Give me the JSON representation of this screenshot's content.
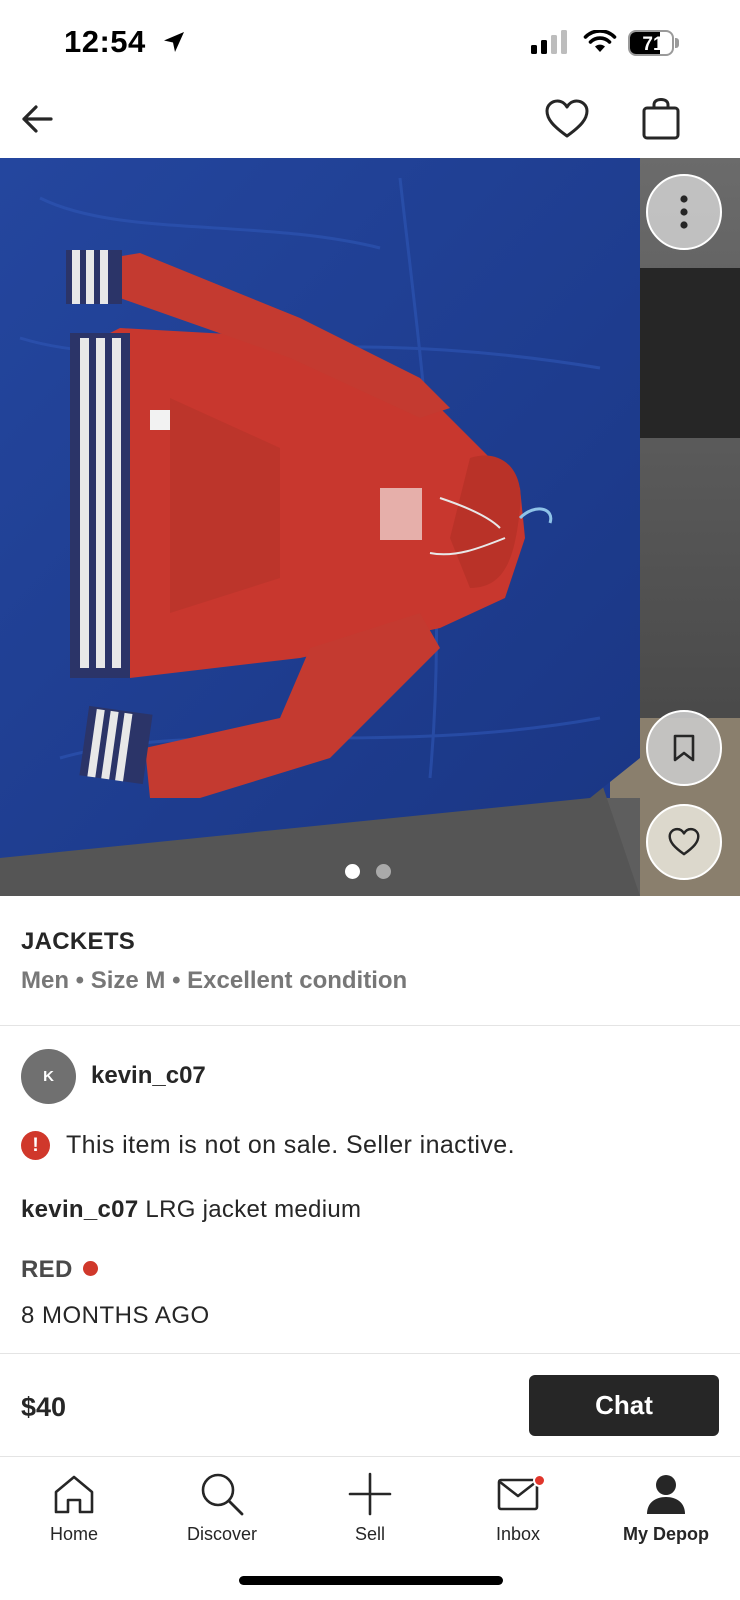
{
  "status_bar": {
    "time": "12:54",
    "battery_percent": 71,
    "battery_label": "71",
    "icons": [
      "location-arrow-icon",
      "signal-bars-icon",
      "wifi-icon",
      "battery-icon"
    ]
  },
  "top_nav": {
    "icons": [
      "back-arrow-icon",
      "heart-outline-icon",
      "shopping-bag-icon"
    ]
  },
  "gallery": {
    "image_count": 2,
    "active_index": 0,
    "icons": [
      "more-vertical-icon",
      "bookmark-icon",
      "heart-icon"
    ]
  },
  "product": {
    "category": "JACKETS",
    "attributes": "Men • Size M • Excellent condition",
    "seller": {
      "avatar_letter": "K",
      "username": "kevin_c07"
    },
    "alert": {
      "icon": "!",
      "text": "This item is not on sale. Seller inactive."
    },
    "description": {
      "username": "kevin_c07",
      "text": " LRG jacket medium"
    },
    "color": {
      "label": "RED",
      "swatch": "#d0382b"
    },
    "posted": "8 MONTHS AGO"
  },
  "action_bar": {
    "price": "$40",
    "chat_label": "Chat"
  },
  "tab_bar": {
    "tabs": [
      {
        "label": "Home",
        "icon": "home-icon"
      },
      {
        "label": "Discover",
        "icon": "search-icon"
      },
      {
        "label": "Sell",
        "icon": "plus-icon"
      },
      {
        "label": "Inbox",
        "icon": "mail-icon"
      },
      {
        "label": "My Depop",
        "icon": "profile-icon",
        "active": true
      }
    ]
  },
  "colors": {
    "text": "#262626",
    "muted": "#777777",
    "alert_red": "#d0382b",
    "chat_button": "#262626"
  }
}
